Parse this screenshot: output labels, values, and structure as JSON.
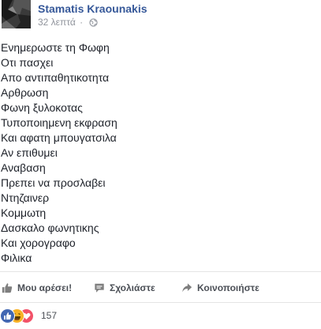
{
  "post": {
    "author": "Stamatis Kraounakis",
    "timestamp": "32 λεπτά",
    "separator": "·",
    "privacy_icon": "globe-icon",
    "lines": [
      "Ενημερωστε τη Φωφη",
      "Οτι πασχει",
      "Απο αντιπαθητικοτητα",
      "Αρθρωση",
      "Φωνη ξυλοκοτας",
      "Τυποποιημενη εκφραση",
      "Και αφατη μπουγατσιλα",
      "Αν επιθυμει",
      "Αναβαση",
      "Πρεπει να προσλαβει",
      "Ντηζαινερ",
      "Κομμωτη",
      "Δασκαλο φωνητικης",
      "Και χορογραφο",
      "Φιλικα"
    ]
  },
  "actions": {
    "like_label": "Μου αρέσει!",
    "comment_label": "Σχολιάστε",
    "share_label": "Κοινοποιήστε"
  },
  "reactions": {
    "icons": [
      "like-reaction-icon",
      "haha-reaction-icon",
      "love-reaction-icon"
    ],
    "count": "157"
  },
  "colors": {
    "author_link": "#365899",
    "meta_gray": "#90949c",
    "text": "#1d2129",
    "action_text": "#4b4f56",
    "like_blue": "#4267b2",
    "haha_yellow": "#f7b125",
    "love_red": "#f25268"
  }
}
